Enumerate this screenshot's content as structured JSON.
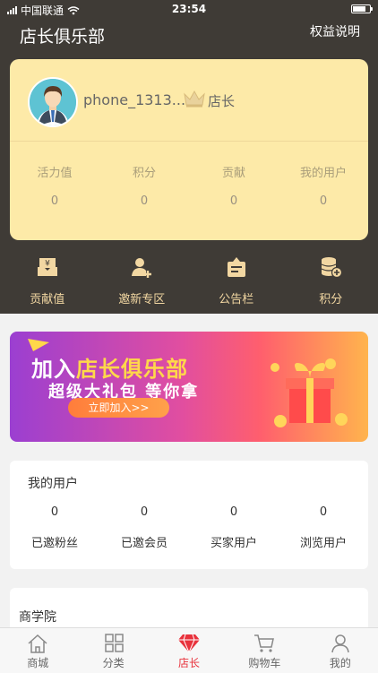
{
  "status_bar": {
    "carrier": "中国联通",
    "time": "23:54"
  },
  "header": {
    "title": "店长俱乐部",
    "right_link": "权益说明"
  },
  "profile": {
    "username": "phone_1313...",
    "role": "店长"
  },
  "stats": [
    {
      "label": "活力值",
      "value": "0"
    },
    {
      "label": "积分",
      "value": "0"
    },
    {
      "label": "贡献",
      "value": "0"
    },
    {
      "label": "我的用户",
      "value": "0"
    }
  ],
  "menu": [
    {
      "label": "贡献值",
      "icon": "money-bag-icon"
    },
    {
      "label": "邀新专区",
      "icon": "invite-user-icon"
    },
    {
      "label": "公告栏",
      "icon": "notice-board-icon"
    },
    {
      "label": "积分",
      "icon": "coins-icon"
    }
  ],
  "banner": {
    "line1_a": "加入",
    "line1_b": "店长俱乐部",
    "line2": "超级大礼包 等你拿",
    "cta": "立即加入>>"
  },
  "my_users": {
    "title": "我的用户",
    "items": [
      {
        "value": "0",
        "label": "已邀粉丝"
      },
      {
        "value": "0",
        "label": "已邀会员"
      },
      {
        "value": "0",
        "label": "买家用户"
      },
      {
        "value": "0",
        "label": "浏览用户"
      }
    ]
  },
  "academy": {
    "title": "商学院"
  },
  "tabbar": [
    {
      "label": "商城",
      "icon": "home-icon"
    },
    {
      "label": "分类",
      "icon": "grid-icon"
    },
    {
      "label": "店长",
      "icon": "diamond-icon",
      "active": true
    },
    {
      "label": "购物车",
      "icon": "cart-icon"
    },
    {
      "label": "我的",
      "icon": "user-icon"
    }
  ],
  "colors": {
    "accent": "#e8323c",
    "header_bg": "#3f3b36",
    "card_bg": "#fdeaa8"
  }
}
